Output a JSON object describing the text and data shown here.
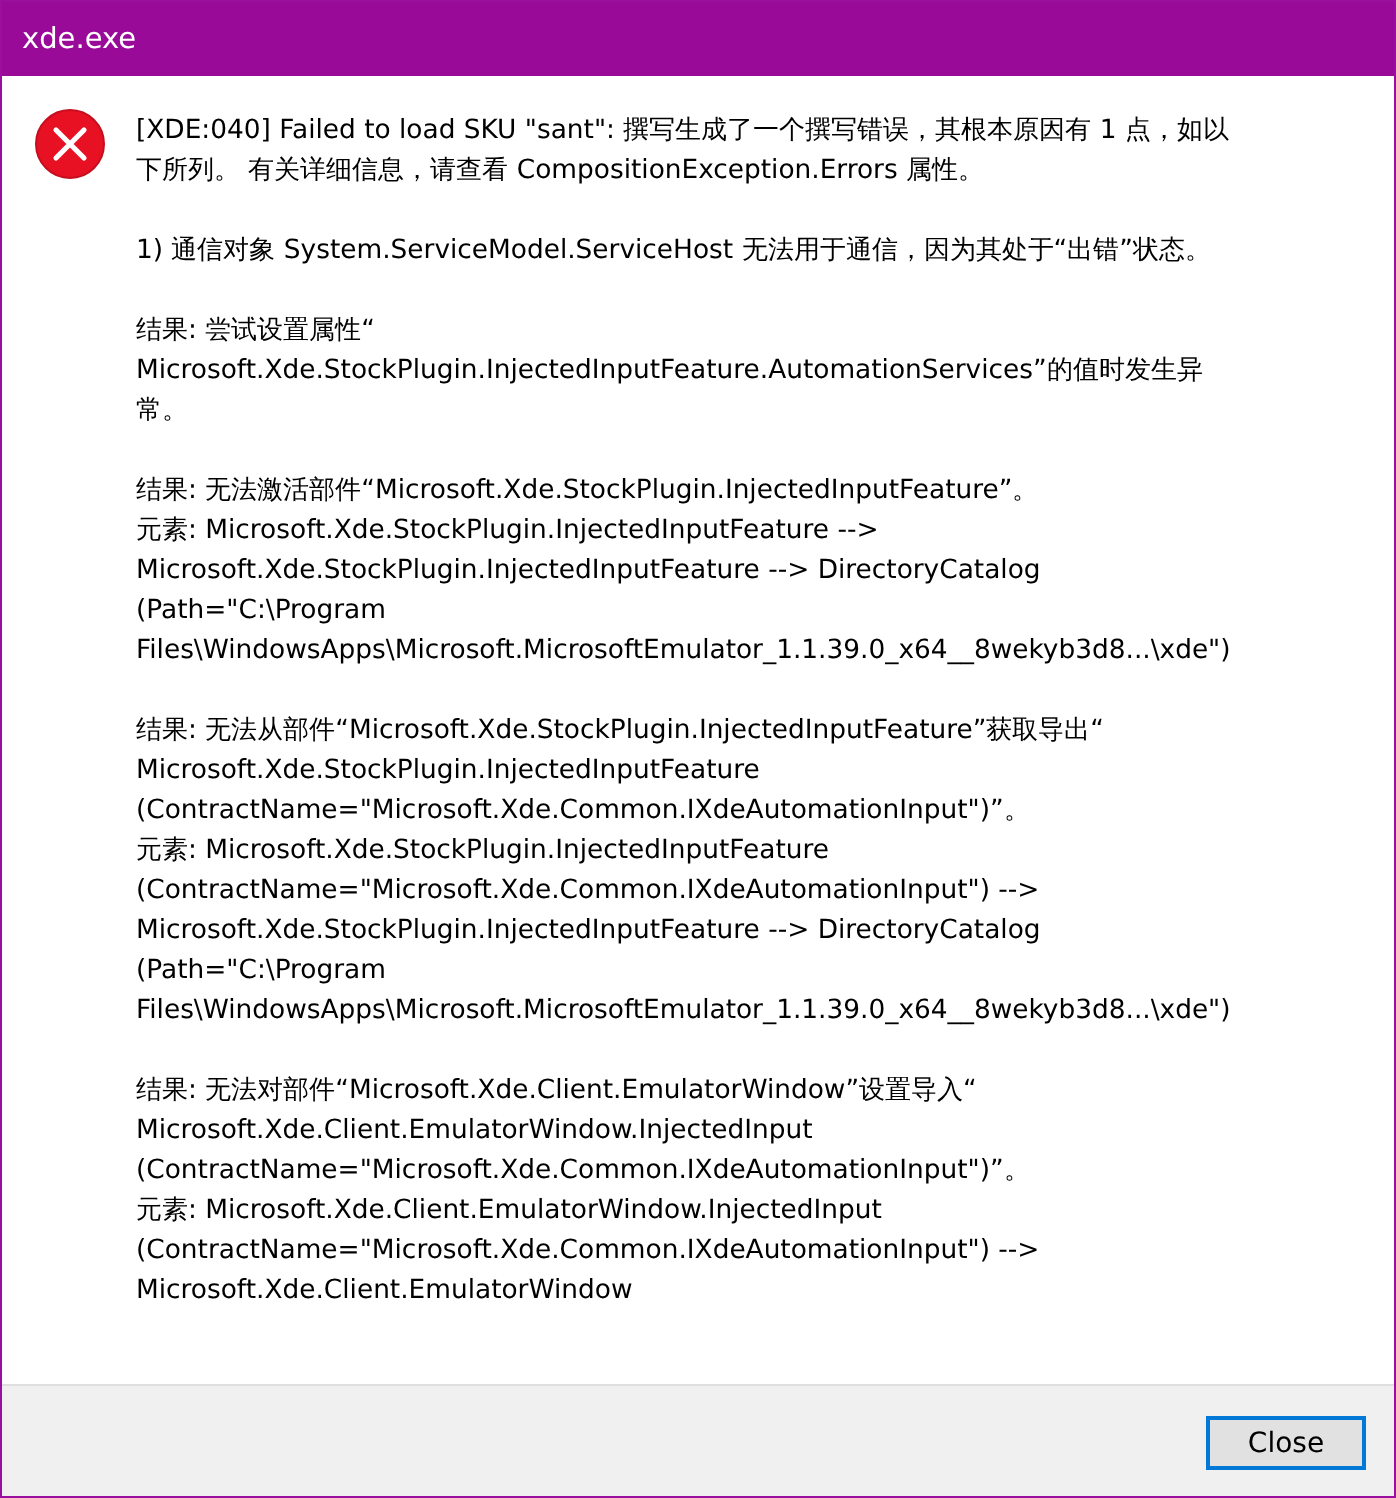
{
  "window": {
    "title": "xde.exe"
  },
  "message": [
    [
      "[XDE:040] Failed to load SKU \"sant\": 撰写生成了一个撰写错误，其根本原因有 1 点，如以",
      "下所列。 有关详细信息，请查看 CompositionException.Errors 属性。"
    ],
    [
      "1) 通信对象 System.ServiceModel.ServiceHost 无法用于通信，因为其处于“出错”状态。"
    ],
    [
      "结果: 尝试设置属性“",
      "Microsoft.Xde.StockPlugin.InjectedInputFeature.AutomationServices”的值时发生异",
      "常。"
    ],
    [
      "结果: 无法激活部件“Microsoft.Xde.StockPlugin.InjectedInputFeature”。",
      "元素: Microsoft.Xde.StockPlugin.InjectedInputFeature -->",
      "Microsoft.Xde.StockPlugin.InjectedInputFeature -->  DirectoryCatalog",
      "(Path=\"C:\\Program",
      "Files\\WindowsApps\\Microsoft.MicrosoftEmulator_1.1.39.0_x64__8wekyb3d8...\\xde\")"
    ],
    [
      "结果: 无法从部件“Microsoft.Xde.StockPlugin.InjectedInputFeature”获取导出“",
      "Microsoft.Xde.StockPlugin.InjectedInputFeature",
      "(ContractName=\"Microsoft.Xde.Common.IXdeAutomationInput\")”。",
      "元素: Microsoft.Xde.StockPlugin.InjectedInputFeature",
      "(ContractName=\"Microsoft.Xde.Common.IXdeAutomationInput\") -->",
      "Microsoft.Xde.StockPlugin.InjectedInputFeature -->  DirectoryCatalog",
      "(Path=\"C:\\Program",
      "Files\\WindowsApps\\Microsoft.MicrosoftEmulator_1.1.39.0_x64__8wekyb3d8...\\xde\")"
    ],
    [
      "结果: 无法对部件“Microsoft.Xde.Client.EmulatorWindow”设置导入“",
      "Microsoft.Xde.Client.EmulatorWindow.InjectedInput",
      "(ContractName=\"Microsoft.Xde.Common.IXdeAutomationInput\")”。",
      "元素: Microsoft.Xde.Client.EmulatorWindow.InjectedInput",
      "(ContractName=\"Microsoft.Xde.Common.IXdeAutomationInput\") -->",
      "Microsoft.Xde.Client.EmulatorWindow"
    ]
  ],
  "buttons": [
    "Close"
  ]
}
